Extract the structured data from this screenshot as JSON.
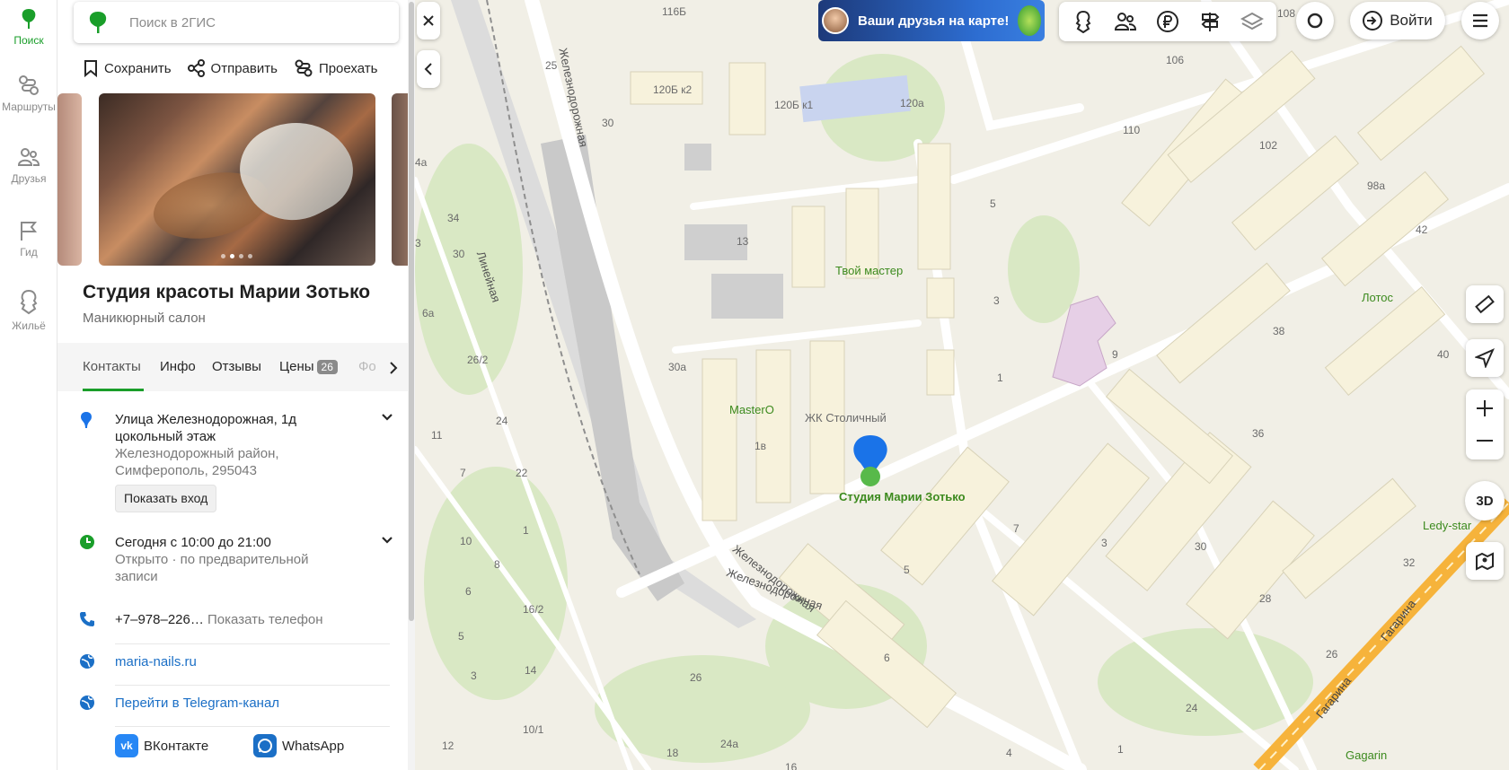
{
  "rail": {
    "items": [
      {
        "label": "Поиск",
        "icon": "leaf-icon"
      },
      {
        "label": "Маршруты",
        "icon": "route-icon"
      },
      {
        "label": "Друзья",
        "icon": "friends-icon"
      },
      {
        "label": "Гид",
        "icon": "flag-icon"
      },
      {
        "label": "Жильё",
        "icon": "house-icon"
      }
    ],
    "active_color": "#1a9e2a"
  },
  "search": {
    "placeholder": "Поиск в 2ГИС"
  },
  "actions": {
    "save": "Сохранить",
    "share": "Отправить",
    "route": "Проехать"
  },
  "place": {
    "name": "Студия красоты Марии Зотько",
    "category": "Маникюрный салон"
  },
  "tabs": {
    "contacts": "Контакты",
    "info": "Инфо",
    "reviews": "Отзывы",
    "prices": "Цены",
    "prices_count": "26",
    "photos": "Фо"
  },
  "address": {
    "line1": "Улица Железнодорожная, 1д",
    "line2": "цокольный этаж",
    "line3": "Железнодорожный район,",
    "line4": "Симферополь, 295043",
    "show_entry": "Показать вход"
  },
  "hours": {
    "today": "Сегодня с 10:00 до 21:00",
    "status": "Открыто",
    "note": "по предварительной",
    "note2": "записи"
  },
  "phone": {
    "number": "+7‒978‒226…",
    "show": "Показать телефон"
  },
  "site": {
    "url": "maria-nails.ru"
  },
  "telegram": {
    "label": "Перейти в Telegram-канал"
  },
  "socials": {
    "vk": "ВКонтакте",
    "whatsapp": "WhatsApp"
  },
  "promo": {
    "text": "Ваши друзья на карте!"
  },
  "login": {
    "label": "Войти"
  },
  "map_controls": {
    "threeD": "3D"
  },
  "map_labels": {
    "house_numbers": [
      "116Б",
      "25",
      "30",
      "120Б к2",
      "120Б к1",
      "120а",
      "106",
      "110",
      "102",
      "98а",
      "42",
      "108",
      "5",
      "13",
      "3",
      "1",
      "9",
      "38",
      "40",
      "36",
      "34",
      "30",
      "26/2",
      "24",
      "11",
      "7",
      "22",
      "1",
      "10",
      "8",
      "6",
      "5",
      "16/2",
      "14",
      "3",
      "10/1",
      "12",
      "18",
      "24а",
      "26",
      "16",
      "30а",
      "1в",
      "7",
      "3",
      "5",
      "6",
      "4",
      "1",
      "24",
      "26",
      "28",
      "30",
      "32",
      "6а",
      "4а",
      "3"
    ],
    "streets": [
      "Железнодорожная",
      "Железнодорожная",
      "Железнодорожная",
      "Линейная",
      "Гагарина",
      "Гагарина"
    ],
    "pois": [
      "Твой мастер",
      "MasterO",
      "ЖК Столичный",
      "Студия Марии Зотько",
      "Лотос",
      "Ledy-star",
      "Gagarin"
    ]
  },
  "colors": {
    "accent": "#1a9e2a",
    "link": "#1b6fc6",
    "pin": "#1a73e8",
    "road_major": "#f6b33b"
  }
}
